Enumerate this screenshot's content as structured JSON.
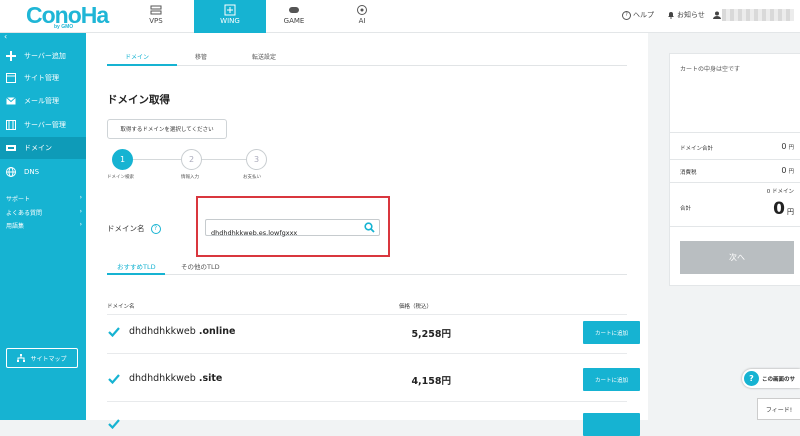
{
  "brand": {
    "logo": "ConoHa",
    "logo_sub": "by GMO"
  },
  "services": [
    {
      "label": "VPS",
      "icon": "server-icon"
    },
    {
      "label": "WING",
      "icon": "wing-icon"
    },
    {
      "label": "GAME",
      "icon": "gamepad-icon"
    },
    {
      "label": "AI",
      "icon": "ai-icon"
    }
  ],
  "header": {
    "help": "ヘルプ",
    "notice": "お知らせ"
  },
  "sidebar": {
    "items": [
      {
        "label": "サーバー追加",
        "icon": "plus-icon"
      },
      {
        "label": "サイト管理",
        "icon": "site-icon"
      },
      {
        "label": "メール管理",
        "icon": "mail-icon"
      },
      {
        "label": "サーバー管理",
        "icon": "server-manage-icon"
      },
      {
        "label": "ドメイン",
        "icon": "domain-icon"
      },
      {
        "label": "DNS",
        "icon": "globe-icon"
      }
    ],
    "sub_links": [
      "サポート",
      "よくある質問",
      "用語集"
    ],
    "sitemap": "サイトマップ"
  },
  "tabs": [
    "ドメイン",
    "移管",
    "転送設定"
  ],
  "page_title": "ドメイン取得",
  "select_button": "取得するドメインを選択してください",
  "steps": [
    {
      "num": "1",
      "label": "ドメイン検索"
    },
    {
      "num": "2",
      "label": "情報入力"
    },
    {
      "num": "3",
      "label": "お支払い"
    }
  ],
  "domain_label": "ドメイン名",
  "search": {
    "value": "dhdhdhkkweb.es.lowfgxxx"
  },
  "tld_tabs": [
    "おすすめTLD",
    "その他のTLD"
  ],
  "columns": {
    "name": "ドメイン名",
    "price": "価格（税込）"
  },
  "results": [
    {
      "name": "dhdhdhkkweb",
      "tld": ".online",
      "price": "5,258円",
      "button": "カートに追加"
    },
    {
      "name": "dhdhdhkkweb",
      "tld": ".site",
      "price": "4,158円",
      "button": "カートに追加"
    }
  ],
  "cart": {
    "empty": "カートの中身は空です",
    "domain_total_label": "ドメイン合計",
    "domain_total_value": "0",
    "tax_label": "消費税",
    "tax_value": "0",
    "unit": "円",
    "count_text": "0 ドメイン",
    "total_label": "合計",
    "total_value": "0",
    "next": "次へ"
  },
  "support_float": "この画面のサ",
  "feedback": "フィード!",
  "colors": {
    "accent": "#16b3d2",
    "highlight": "#d9363e"
  }
}
